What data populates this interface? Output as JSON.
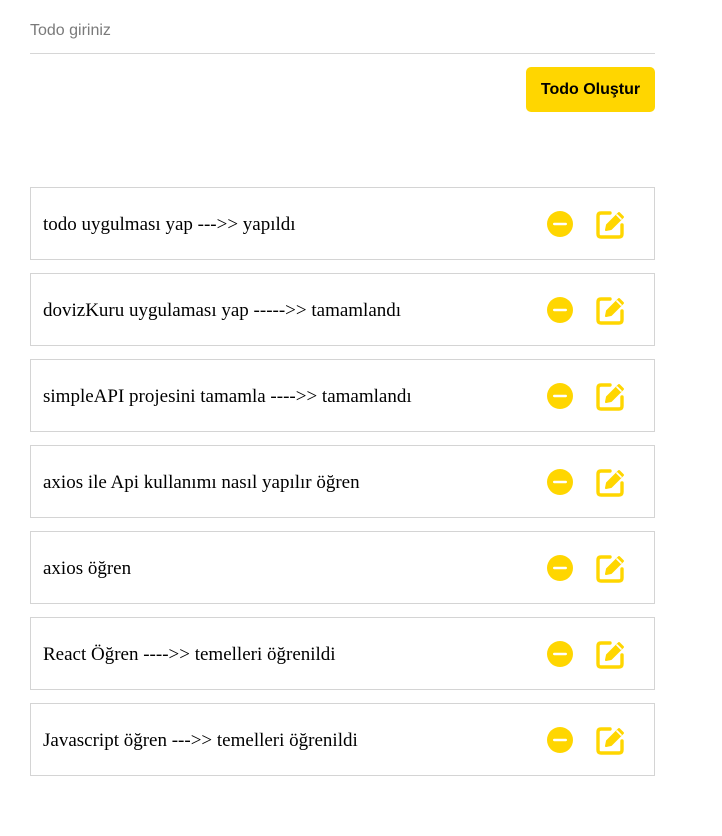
{
  "form": {
    "input_value": "",
    "input_placeholder": "Todo giriniz",
    "create_button_label": "Todo Oluştur"
  },
  "colors": {
    "accent": "#ffd600",
    "border": "#d4d4d4"
  },
  "icons": {
    "remove": "minus-circle-icon",
    "edit": "edit-square-icon"
  },
  "todos": [
    {
      "text": "todo uygulması yap --->> yapıldı"
    },
    {
      "text": "dovizKuru uygulaması yap ----->> tamamlandı"
    },
    {
      "text": "simpleAPI projesini tamamla ---->> tamamlandı"
    },
    {
      "text": "axios ile Api kullanımı nasıl yapılır öğren"
    },
    {
      "text": "axios öğren"
    },
    {
      "text": "React Öğren ---->> temelleri öğrenildi"
    },
    {
      "text": "Javascript öğren --->> temelleri öğrenildi"
    }
  ]
}
